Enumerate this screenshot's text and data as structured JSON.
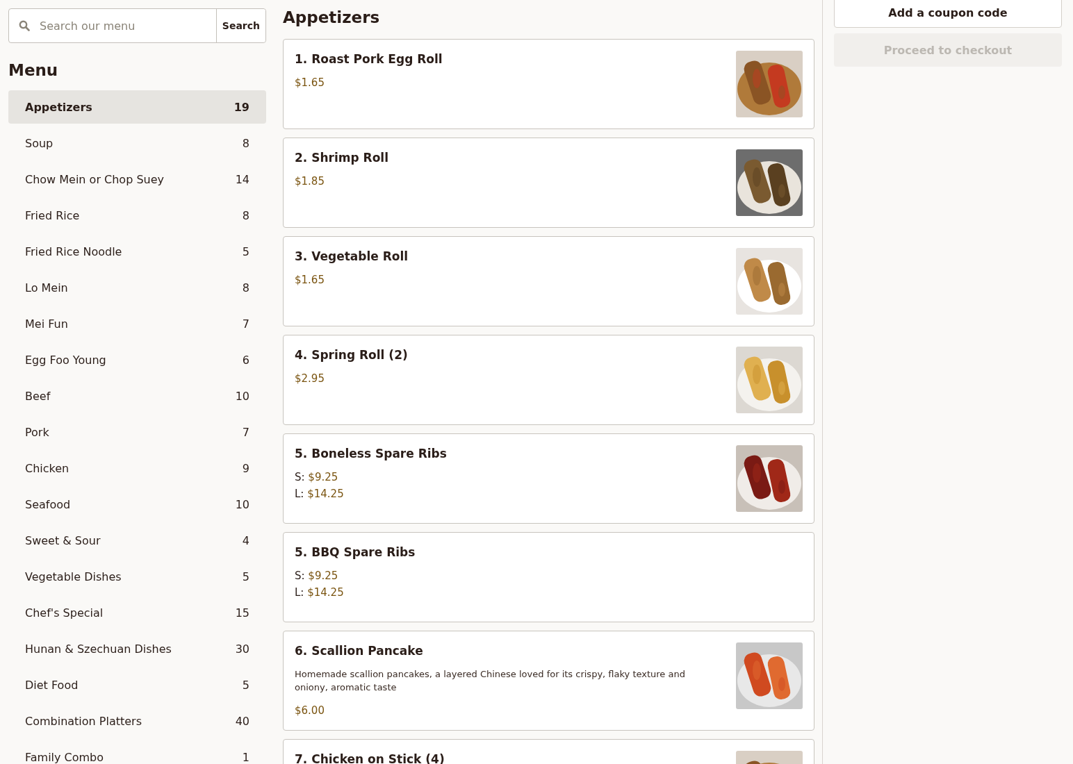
{
  "search": {
    "placeholder": "Search our menu",
    "button": "Search"
  },
  "sidebar": {
    "title": "Menu",
    "items": [
      {
        "label": "Appetizers",
        "count": "19",
        "selected": true
      },
      {
        "label": "Soup",
        "count": "8",
        "selected": false
      },
      {
        "label": "Chow Mein or Chop Suey",
        "count": "14",
        "selected": false
      },
      {
        "label": "Fried Rice",
        "count": "8",
        "selected": false
      },
      {
        "label": "Fried Rice Noodle",
        "count": "5",
        "selected": false
      },
      {
        "label": "Lo Mein",
        "count": "8",
        "selected": false
      },
      {
        "label": "Mei Fun",
        "count": "7",
        "selected": false
      },
      {
        "label": "Egg Foo Young",
        "count": "6",
        "selected": false
      },
      {
        "label": "Beef",
        "count": "10",
        "selected": false
      },
      {
        "label": "Pork",
        "count": "7",
        "selected": false
      },
      {
        "label": "Chicken",
        "count": "9",
        "selected": false
      },
      {
        "label": "Seafood",
        "count": "10",
        "selected": false
      },
      {
        "label": "Sweet & Sour",
        "count": "4",
        "selected": false
      },
      {
        "label": "Vegetable Dishes",
        "count": "5",
        "selected": false
      },
      {
        "label": "Chef's Special",
        "count": "15",
        "selected": false
      },
      {
        "label": "Hunan & Szechuan Dishes",
        "count": "30",
        "selected": false
      },
      {
        "label": "Diet Food",
        "count": "5",
        "selected": false
      },
      {
        "label": "Combination Platters",
        "count": "40",
        "selected": false
      },
      {
        "label": "Family Combo",
        "count": "1",
        "selected": false
      }
    ]
  },
  "section": {
    "title": "Appetizers",
    "items": [
      {
        "name": "1. Roast Pork Egg Roll",
        "prices": [
          {
            "amount": "$1.65"
          }
        ],
        "image": {
          "kind": "picture"
        }
      },
      {
        "name": "2. Shrimp Roll",
        "prices": [
          {
            "amount": "$1.85"
          }
        ],
        "image": {
          "kind": "picture"
        }
      },
      {
        "name": "3. Vegetable Roll",
        "prices": [
          {
            "amount": "$1.65"
          }
        ],
        "image": {
          "kind": "picture"
        }
      },
      {
        "name": "4. Spring Roll (2)",
        "prices": [
          {
            "amount": "$2.95"
          }
        ],
        "image": {
          "kind": "picture"
        }
      },
      {
        "name": "5. Boneless Spare Ribs",
        "prices": [
          {
            "size": "S:",
            "amount": "$9.25"
          },
          {
            "size": "L:",
            "amount": "$14.25"
          }
        ],
        "image": {
          "kind": "picture"
        }
      },
      {
        "name": "5. BBQ Spare Ribs",
        "prices": [
          {
            "size": "S:",
            "amount": "$9.25"
          },
          {
            "size": "L:",
            "amount": "$14.25"
          }
        ]
      },
      {
        "name": "6. Scallion Pancake",
        "description": "Homemade scallion pancakes, a layered Chinese loved for its crispy, flaky texture and oniony, aromatic taste",
        "prices": [
          {
            "amount": "$6.00"
          }
        ],
        "image": {
          "kind": "picture"
        }
      },
      {
        "name": "7. Chicken on Stick (4)",
        "image": {
          "kind": "picture"
        }
      }
    ]
  },
  "cart": {
    "coupon_button": "Add a coupon code",
    "checkout_button": {
      "label": "Proceed to checkout",
      "disabled": true
    }
  }
}
